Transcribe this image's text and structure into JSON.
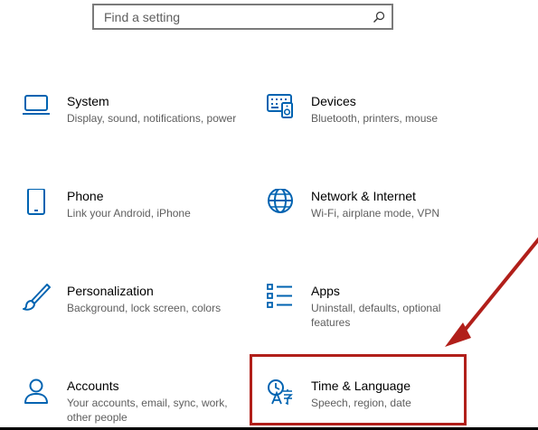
{
  "search": {
    "placeholder": "Find a setting"
  },
  "tiles": [
    {
      "id": "system",
      "title": "System",
      "desc": "Display, sound, notifications, power",
      "icon": "laptop-icon"
    },
    {
      "id": "devices",
      "title": "Devices",
      "desc": "Bluetooth, printers, mouse",
      "icon": "keyboard-speaker-icon"
    },
    {
      "id": "phone",
      "title": "Phone",
      "desc": "Link your Android, iPhone",
      "icon": "phone-icon"
    },
    {
      "id": "network",
      "title": "Network & Internet",
      "desc": "Wi-Fi, airplane mode, VPN",
      "icon": "globe-icon"
    },
    {
      "id": "personalization",
      "title": "Personalization",
      "desc": "Background, lock screen, colors",
      "icon": "paintbrush-icon"
    },
    {
      "id": "apps",
      "title": "Apps",
      "desc": "Uninstall, defaults, optional features",
      "icon": "apps-list-icon"
    },
    {
      "id": "accounts",
      "title": "Accounts",
      "desc": "Your accounts, email, sync, work, other people",
      "icon": "person-icon"
    },
    {
      "id": "time-language",
      "title": "Time & Language",
      "desc": "Speech, region, date",
      "icon": "time-language-icon"
    }
  ],
  "colors": {
    "accent": "#0063b1",
    "highlight": "#b11f1a"
  }
}
